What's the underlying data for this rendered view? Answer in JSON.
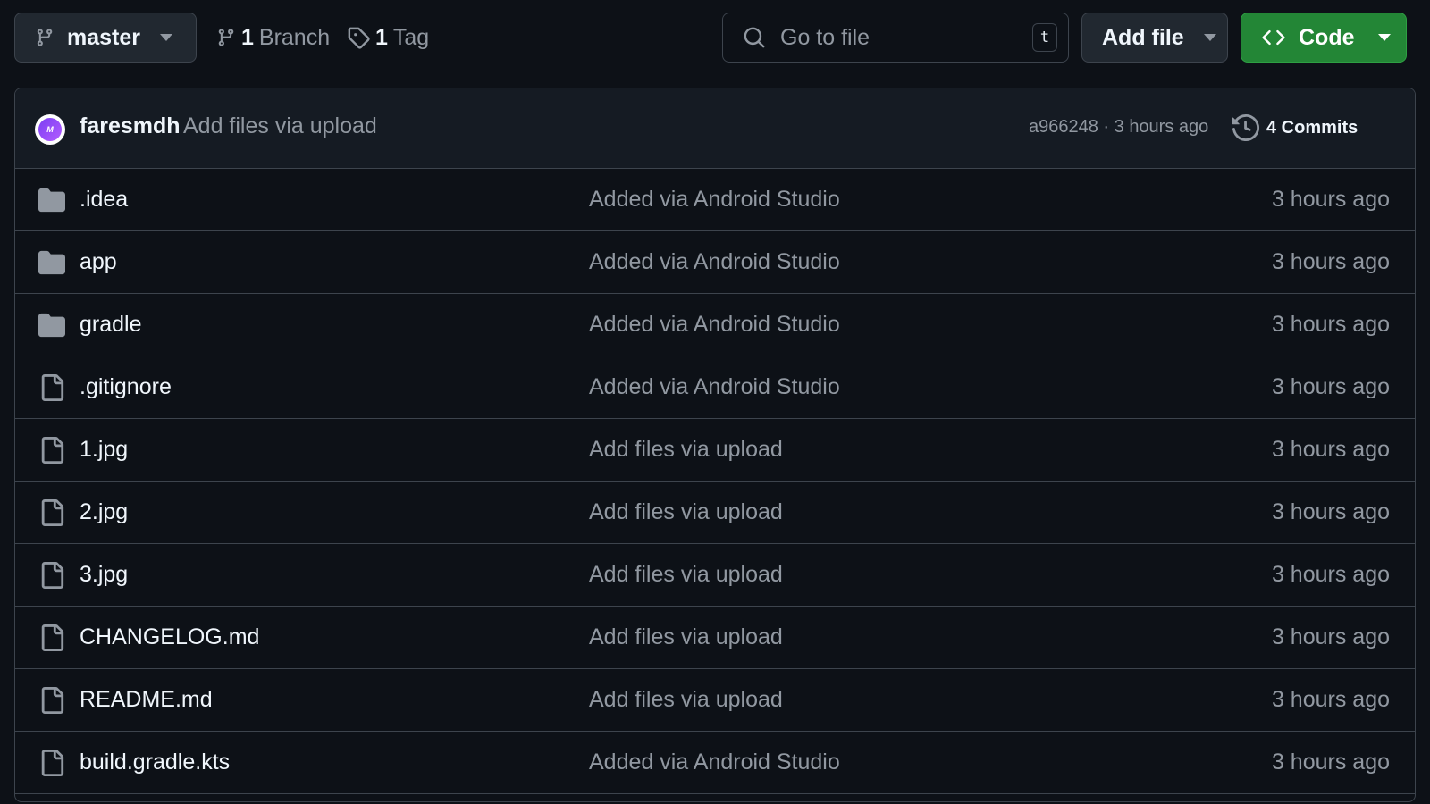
{
  "toolbar": {
    "branch_label": "master",
    "branches_count": "1",
    "branches_label": "Branch",
    "tags_count": "1",
    "tags_label": "Tag",
    "search_placeholder": "Go to file",
    "search_shortcut": "t",
    "add_file_label": "Add file",
    "code_label": "Code"
  },
  "latest_commit": {
    "author": "faresmdh",
    "message": "Add files via upload",
    "sha_time": "a966248 · 3 hours ago",
    "commits_label": "4 Commits"
  },
  "files": [
    {
      "name": ".idea",
      "type": "folder",
      "message": "Added via Android Studio",
      "time": "3 hours ago"
    },
    {
      "name": "app",
      "type": "folder",
      "message": "Added via Android Studio",
      "time": "3 hours ago"
    },
    {
      "name": "gradle",
      "type": "folder",
      "message": "Added via Android Studio",
      "time": "3 hours ago"
    },
    {
      "name": ".gitignore",
      "type": "file",
      "message": "Added via Android Studio",
      "time": "3 hours ago"
    },
    {
      "name": "1.jpg",
      "type": "file",
      "message": "Add files via upload",
      "time": "3 hours ago"
    },
    {
      "name": "2.jpg",
      "type": "file",
      "message": "Add files via upload",
      "time": "3 hours ago"
    },
    {
      "name": "3.jpg",
      "type": "file",
      "message": "Add files via upload",
      "time": "3 hours ago"
    },
    {
      "name": "CHANGELOG.md",
      "type": "file",
      "message": "Add files via upload",
      "time": "3 hours ago"
    },
    {
      "name": "README.md",
      "type": "file",
      "message": "Add files via upload",
      "time": "3 hours ago"
    },
    {
      "name": "build.gradle.kts",
      "type": "file",
      "message": "Added via Android Studio",
      "time": "3 hours ago"
    }
  ],
  "colors": {
    "background": "#0d1117",
    "border": "#3d444d",
    "muted_text": "#9198a1",
    "code_button": "#238636"
  }
}
